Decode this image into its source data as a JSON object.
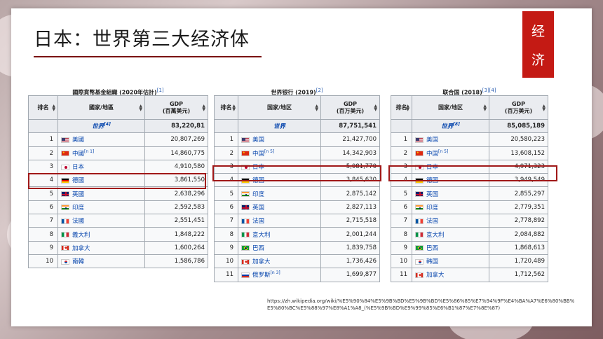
{
  "title": "日本：世界第三大经济体",
  "tag": [
    "经",
    "济"
  ],
  "source_url": "https://zh.wikipedia.org/wiki/%E5%90%84%E5%9B%BD%E5%9B%BD%E5%86%85%E7%94%9F%E4%BA%A7%E6%80%BB%E5%80%BC%E5%88%97%E8%A1%A8_(%E5%9B%BD%E9%99%85%E6%B1%87%E7%8E%87)",
  "panels": [
    {
      "title": "國際貨幣基金組織 (2020年估計)",
      "ref": "[1]",
      "headers": {
        "rank": "排名",
        "country": "國家/地區",
        "gdp": "GDP",
        "unit": "(百萬美元)"
      },
      "world": {
        "label": "世界",
        "ref": "[4]",
        "value": "83,220,81"
      },
      "rows": [
        {
          "rank": "1",
          "country": "美國",
          "flag": "us",
          "ref": "",
          "gdp": "20,807,269"
        },
        {
          "rank": "2",
          "country": "中國",
          "flag": "cn",
          "ref": "[n 1]",
          "gdp": "14,860,775"
        },
        {
          "rank": "3",
          "country": "日本",
          "flag": "jp",
          "ref": "",
          "gdp": "4,910,580"
        },
        {
          "rank": "4",
          "country": "德國",
          "flag": "de",
          "ref": "",
          "gdp": "3,861,550"
        },
        {
          "rank": "5",
          "country": "英國",
          "flag": "gb",
          "ref": "",
          "gdp": "2,638,296"
        },
        {
          "rank": "6",
          "country": "印度",
          "flag": "in",
          "ref": "",
          "gdp": "2,592,583"
        },
        {
          "rank": "7",
          "country": "法國",
          "flag": "fr",
          "ref": "",
          "gdp": "2,551,451"
        },
        {
          "rank": "8",
          "country": "義大利",
          "flag": "it",
          "ref": "",
          "gdp": "1,848,222"
        },
        {
          "rank": "9",
          "country": "加拿大",
          "flag": "ca",
          "ref": "",
          "gdp": "1,600,264"
        },
        {
          "rank": "10",
          "country": "南韓",
          "flag": "kr",
          "ref": "",
          "gdp": "1,586,786"
        }
      ]
    },
    {
      "title": "世界银行 (2019)",
      "ref": "[2]",
      "headers": {
        "rank": "排名",
        "country": "国家/地区",
        "gdp": "GDP",
        "unit": "(百万美元)"
      },
      "world": {
        "label": "世界",
        "ref": "",
        "value": "87,751,541"
      },
      "rows": [
        {
          "rank": "1",
          "country": "美国",
          "flag": "us",
          "ref": "",
          "gdp": "21,427,700"
        },
        {
          "rank": "2",
          "country": "中国",
          "flag": "cn",
          "ref": "[n 5]",
          "gdp": "14,342,903"
        },
        {
          "rank": "3",
          "country": "日本",
          "flag": "jp",
          "ref": "",
          "gdp": "5,081,770"
        },
        {
          "rank": "4",
          "country": "德国",
          "flag": "de",
          "ref": "",
          "gdp": "3,845,630"
        },
        {
          "rank": "5",
          "country": "印度",
          "flag": "in",
          "ref": "",
          "gdp": "2,875,142"
        },
        {
          "rank": "6",
          "country": "英国",
          "flag": "gb",
          "ref": "",
          "gdp": "2,827,113"
        },
        {
          "rank": "7",
          "country": "法国",
          "flag": "fr",
          "ref": "",
          "gdp": "2,715,518"
        },
        {
          "rank": "8",
          "country": "意大利",
          "flag": "it",
          "ref": "",
          "gdp": "2,001,244"
        },
        {
          "rank": "9",
          "country": "巴西",
          "flag": "br",
          "ref": "",
          "gdp": "1,839,758"
        },
        {
          "rank": "10",
          "country": "加拿大",
          "flag": "ca",
          "ref": "",
          "gdp": "1,736,426"
        },
        {
          "rank": "11",
          "country": "俄罗斯",
          "flag": "ru",
          "ref": "[n 3]",
          "gdp": "1,699,877"
        }
      ]
    },
    {
      "title": "联合国 (2018)",
      "ref": "[3][4]",
      "headers": {
        "rank": "排名",
        "country": "国家/地区",
        "gdp": "GDP",
        "unit": "(百万美元)"
      },
      "world": {
        "label": "世界",
        "ref": "[8]",
        "value": "85,085,189"
      },
      "rows": [
        {
          "rank": "1",
          "country": "美国",
          "flag": "us",
          "ref": "",
          "gdp": "20,580,223"
        },
        {
          "rank": "2",
          "country": "中国",
          "flag": "cn",
          "ref": "[n 5]",
          "gdp": "13,608,152"
        },
        {
          "rank": "3",
          "country": "日本",
          "flag": "jp",
          "ref": "",
          "gdp": "4,971,323"
        },
        {
          "rank": "4",
          "country": "德国",
          "flag": "de",
          "ref": "",
          "gdp": "3,949,549"
        },
        {
          "rank": "5",
          "country": "英国",
          "flag": "gb",
          "ref": "",
          "gdp": "2,855,297"
        },
        {
          "rank": "6",
          "country": "印度",
          "flag": "in",
          "ref": "",
          "gdp": "2,779,351"
        },
        {
          "rank": "7",
          "country": "法国",
          "flag": "fr",
          "ref": "",
          "gdp": "2,778,892"
        },
        {
          "rank": "8",
          "country": "意大利",
          "flag": "it",
          "ref": "",
          "gdp": "2,084,882"
        },
        {
          "rank": "9",
          "country": "巴西",
          "flag": "br",
          "ref": "",
          "gdp": "1,868,613"
        },
        {
          "rank": "10",
          "country": "韩国",
          "flag": "kr",
          "ref": "",
          "gdp": "1,720,489"
        },
        {
          "rank": "11",
          "country": "加拿大",
          "flag": "ca",
          "ref": "",
          "gdp": "1,712,562"
        }
      ]
    }
  ]
}
